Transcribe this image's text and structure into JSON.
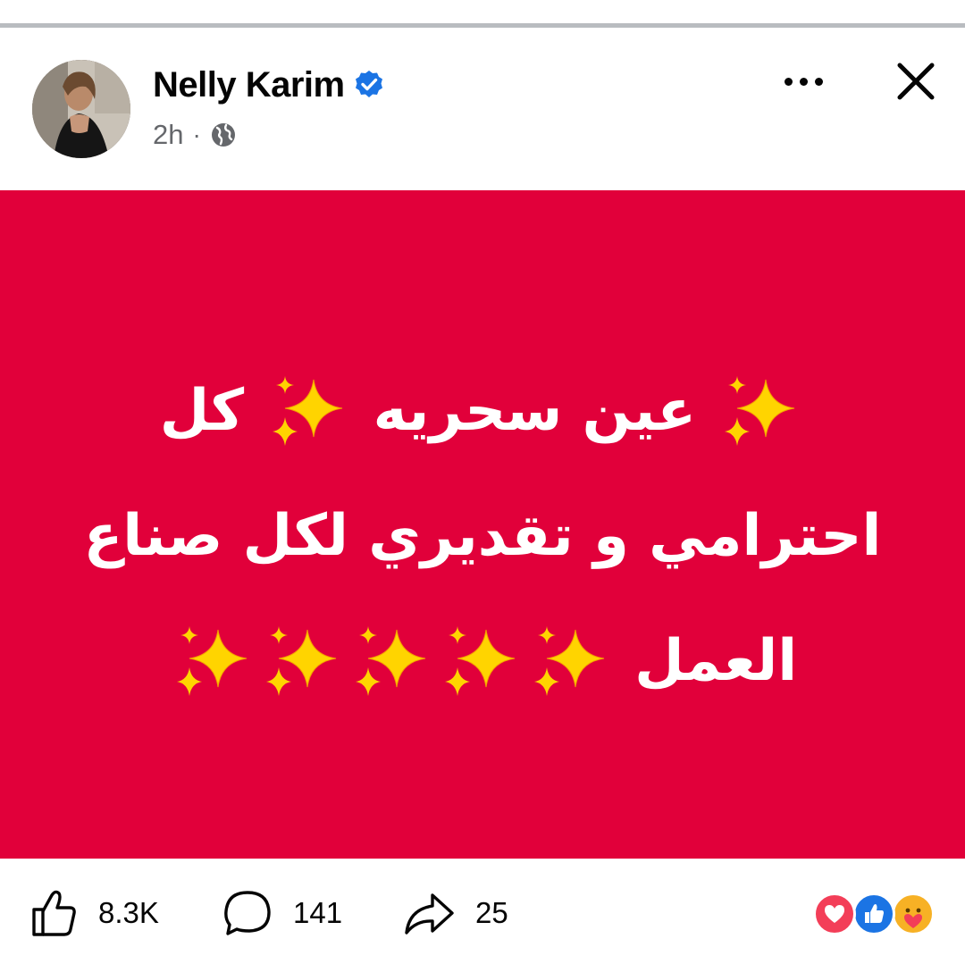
{
  "post": {
    "author": "Nelly Karim",
    "timestamp": "2h",
    "separator": "·",
    "verified_icon": "verified-badge-icon",
    "audience_icon": "globe-icon",
    "body_lines": [
      "عين سحريه",
      "كل",
      "احترامي و تقديري لكل صناع",
      "العمل"
    ],
    "background_color": "#e1003a",
    "text_color": "#ffffff"
  },
  "footer": {
    "likes": "8.3K",
    "comments": "141",
    "shares": "25",
    "reactions": [
      "love",
      "like",
      "care"
    ]
  },
  "colors": {
    "brand_blue": "#1b74e4",
    "muted": "#65676b",
    "love": "#f33e58",
    "care": "#f7b125"
  }
}
